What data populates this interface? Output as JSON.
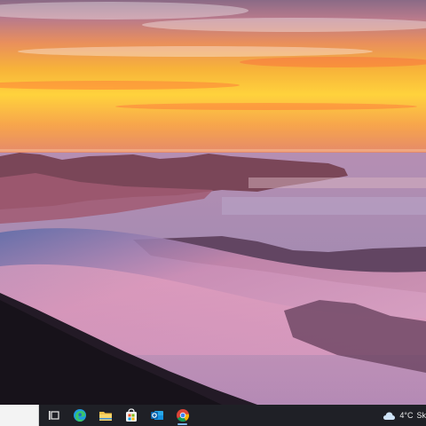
{
  "desktop": {
    "wallpaper": "sunset-over-fog-covered-coastline"
  },
  "taskbar": {
    "search_box_value": "",
    "items": [
      {
        "name": "task-view",
        "icon": "task-view-icon"
      },
      {
        "name": "edge",
        "icon": "edge-icon"
      },
      {
        "name": "file-explorer",
        "icon": "folder-icon"
      },
      {
        "name": "microsoft-store",
        "icon": "store-icon"
      },
      {
        "name": "outlook",
        "icon": "outlook-icon"
      },
      {
        "name": "chrome",
        "icon": "chrome-icon",
        "active": true
      }
    ],
    "weather": {
      "icon": "cloud-icon",
      "temperature": "4°C",
      "condition": "Sk"
    }
  },
  "colors": {
    "taskbar_bg": "#1f2026",
    "active_indicator": "#7fb7ea",
    "search_box_bg": "#f3f3f3"
  }
}
